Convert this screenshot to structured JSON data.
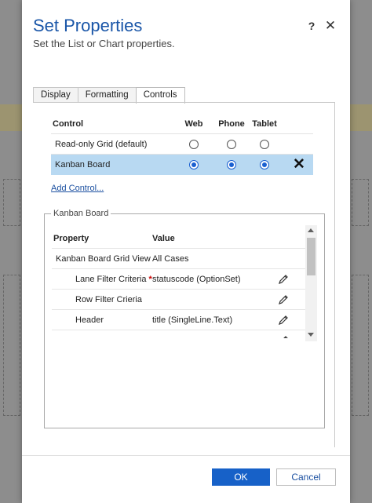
{
  "dialog": {
    "title": "Set Properties",
    "subtitle": "Set the List or Chart properties.",
    "help_glyph": "?",
    "close_glyph": "✕"
  },
  "tabs": [
    {
      "label": "Display",
      "active": false
    },
    {
      "label": "Formatting",
      "active": false
    },
    {
      "label": "Controls",
      "active": true
    }
  ],
  "controls": {
    "columns": [
      "Control",
      "Web",
      "Phone",
      "Tablet"
    ],
    "rows": [
      {
        "name": "Read-only Grid (default)",
        "web": false,
        "phone": false,
        "tablet": false,
        "selected": false
      },
      {
        "name": "Kanban Board",
        "web": true,
        "phone": true,
        "tablet": true,
        "selected": true
      }
    ],
    "add_link": "Add Control..."
  },
  "kanban": {
    "legend": "Kanban Board",
    "columns": [
      "Property",
      "Value"
    ],
    "rows": [
      {
        "name": "Kanban Board Grid View",
        "value": "All Cases",
        "editable": false,
        "required": false,
        "indent": 1
      },
      {
        "name": "Lane Filter Criteria",
        "value": "statuscode (OptionSet)",
        "editable": true,
        "required": true,
        "indent": 2
      },
      {
        "name": "Row Filter Crieria",
        "value": "",
        "editable": true,
        "required": false,
        "indent": 2
      },
      {
        "name": "Header",
        "value": "title (SingleLine.Text)",
        "editable": true,
        "required": false,
        "indent": 2
      }
    ]
  },
  "footer": {
    "ok_label": "OK",
    "cancel_label": "Cancel"
  },
  "colors": {
    "accent": "#1761c8",
    "title": "#1a56a8",
    "selected_row": "#b8d9f2"
  }
}
